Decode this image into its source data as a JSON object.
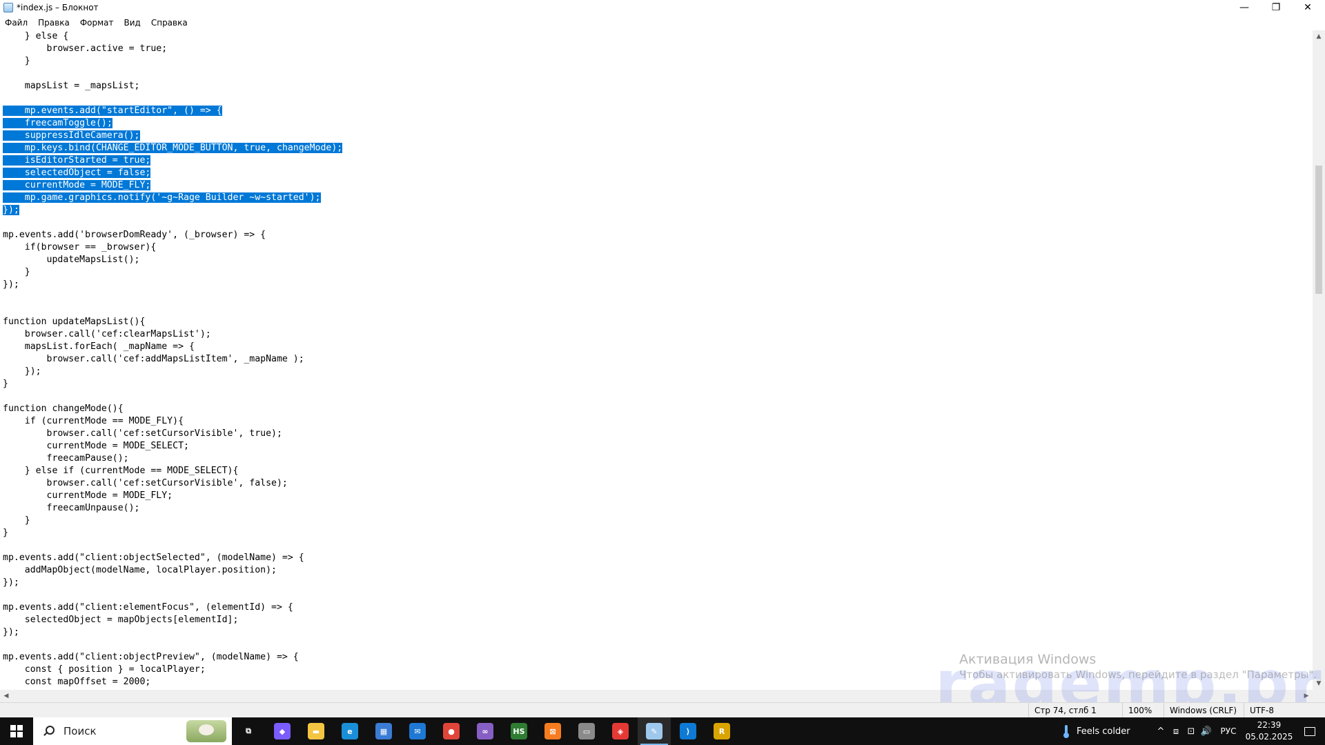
{
  "window": {
    "title": "*index.js – Блокнот",
    "controls": {
      "minimize": "—",
      "maximize": "❐",
      "close": "✕"
    }
  },
  "menu": [
    "Файл",
    "Правка",
    "Формат",
    "Вид",
    "Справка"
  ],
  "editor": {
    "selection_color": "#0078d7",
    "lines": [
      {
        "text": "    } else {",
        "selected": false
      },
      {
        "text": "        browser.active = true;",
        "selected": false
      },
      {
        "text": "    }",
        "selected": false
      },
      {
        "text": "",
        "selected": false
      },
      {
        "text": "    mapsList = _mapsList;",
        "selected": false
      },
      {
        "text": "",
        "selected": false
      },
      {
        "text": "    mp.events.add(\"startEditor\", () => {",
        "selected": true
      },
      {
        "text": "    freecamToggle();",
        "selected": true
      },
      {
        "text": "    suppressIdleCamera();",
        "selected": true
      },
      {
        "text": "    mp.keys.bind(CHANGE_EDITOR_MODE_BUTTON, true, changeMode);",
        "selected": true
      },
      {
        "text": "    isEditorStarted = true;",
        "selected": true
      },
      {
        "text": "    selectedObject = false;",
        "selected": true
      },
      {
        "text": "    currentMode = MODE_FLY;",
        "selected": true
      },
      {
        "text": "    mp.game.graphics.notify('~g~Rage Builder ~w~started');",
        "selected": true
      },
      {
        "text": "});",
        "selected": true
      },
      {
        "text": "",
        "selected": false
      },
      {
        "text": "mp.events.add('browserDomReady', (_browser) => {",
        "selected": false
      },
      {
        "text": "    if(browser == _browser){",
        "selected": false
      },
      {
        "text": "        updateMapsList();",
        "selected": false
      },
      {
        "text": "    }",
        "selected": false
      },
      {
        "text": "});",
        "selected": false
      },
      {
        "text": "",
        "selected": false
      },
      {
        "text": "",
        "selected": false
      },
      {
        "text": "function updateMapsList(){",
        "selected": false
      },
      {
        "text": "    browser.call('cef:clearMapsList');",
        "selected": false
      },
      {
        "text": "    mapsList.forEach( _mapName => {",
        "selected": false
      },
      {
        "text": "        browser.call('cef:addMapsListItem', _mapName );",
        "selected": false
      },
      {
        "text": "    });",
        "selected": false
      },
      {
        "text": "}",
        "selected": false
      },
      {
        "text": "",
        "selected": false
      },
      {
        "text": "function changeMode(){",
        "selected": false
      },
      {
        "text": "    if (currentMode == MODE_FLY){",
        "selected": false
      },
      {
        "text": "        browser.call('cef:setCursorVisible', true);",
        "selected": false
      },
      {
        "text": "        currentMode = MODE_SELECT;",
        "selected": false
      },
      {
        "text": "        freecamPause();",
        "selected": false
      },
      {
        "text": "    } else if (currentMode == MODE_SELECT){",
        "selected": false
      },
      {
        "text": "        browser.call('cef:setCursorVisible', false);",
        "selected": false
      },
      {
        "text": "        currentMode = MODE_FLY;",
        "selected": false
      },
      {
        "text": "        freecamUnpause();",
        "selected": false
      },
      {
        "text": "    }",
        "selected": false
      },
      {
        "text": "}",
        "selected": false
      },
      {
        "text": "",
        "selected": false
      },
      {
        "text": "mp.events.add(\"client:objectSelected\", (modelName) => {",
        "selected": false
      },
      {
        "text": "    addMapObject(modelName, localPlayer.position);",
        "selected": false
      },
      {
        "text": "});",
        "selected": false
      },
      {
        "text": "",
        "selected": false
      },
      {
        "text": "mp.events.add(\"client:elementFocus\", (elementId) => {",
        "selected": false
      },
      {
        "text": "    selectedObject = mapObjects[elementId];",
        "selected": false
      },
      {
        "text": "});",
        "selected": false
      },
      {
        "text": "",
        "selected": false
      },
      {
        "text": "mp.events.add(\"client:objectPreview\", (modelName) => {",
        "selected": false
      },
      {
        "text": "    const { position } = localPlayer;",
        "selected": false
      },
      {
        "text": "    const mapOffset = 2000;",
        "selected": false
      }
    ]
  },
  "statusbar": {
    "position": "Стр 74, стлб 1",
    "zoom": "100%",
    "line_endings": "Windows (CRLF)",
    "encoding": "UTF-8"
  },
  "activation": {
    "title": "Активация Windows",
    "subtitle": "Чтобы активировать Windows, перейдите в раздел \"Параметры\"."
  },
  "brand_watermark": "ragemp.pro",
  "taskbar": {
    "search_placeholder": "Поиск",
    "apps": [
      {
        "name": "task-view",
        "glyph": "⧉",
        "color": "#101010"
      },
      {
        "name": "copilot",
        "glyph": "◆",
        "color": "#7b5cff"
      },
      {
        "name": "file-explorer",
        "glyph": "▬",
        "color": "#f4c542"
      },
      {
        "name": "edge",
        "glyph": "e",
        "color": "#1a8fd8"
      },
      {
        "name": "store",
        "glyph": "▦",
        "color": "#3a7bd5"
      },
      {
        "name": "mail",
        "glyph": "✉",
        "color": "#1e78d4"
      },
      {
        "name": "chrome",
        "glyph": "●",
        "color": "#e0453a"
      },
      {
        "name": "visual-studio",
        "glyph": "∞",
        "color": "#865fc5"
      },
      {
        "name": "hs-app",
        "glyph": "HS",
        "color": "#2e7d32"
      },
      {
        "name": "xampp",
        "glyph": "⊠",
        "color": "#f57c20"
      },
      {
        "name": "sticky-app",
        "glyph": "▭",
        "color": "#8a8a8a"
      },
      {
        "name": "anydesk",
        "glyph": "◈",
        "color": "#e53935"
      },
      {
        "name": "notepad",
        "glyph": "✎",
        "color": "#9fc9ec"
      },
      {
        "name": "vscode",
        "glyph": "⟩",
        "color": "#0e7ad3"
      },
      {
        "name": "rage-app",
        "glyph": "R",
        "color": "#d9a400"
      }
    ],
    "weather": "Feels colder",
    "tray_icons": [
      "^",
      "⧈",
      "⊡",
      "🔊"
    ],
    "language": "РУС",
    "time": "22:39",
    "date": "05.02.2025"
  }
}
